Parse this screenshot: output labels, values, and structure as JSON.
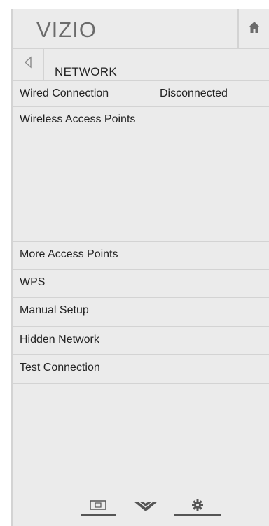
{
  "header": {
    "logo": "VIZIO",
    "home_icon": "home-icon"
  },
  "nav": {
    "back_icon": "back-arrow-icon",
    "title": "NETWORK"
  },
  "menu": {
    "wired_label": "Wired Connection",
    "wired_status": "Disconnected",
    "wireless_label": "Wireless Access Points",
    "items": [
      "More Access Points",
      "WPS",
      "Manual Setup",
      "Hidden Network",
      "Test Connection"
    ]
  },
  "bottom_bar": {
    "icons": [
      "picture-mode-icon",
      "chevron-down-icon",
      "settings-gear-icon"
    ]
  }
}
